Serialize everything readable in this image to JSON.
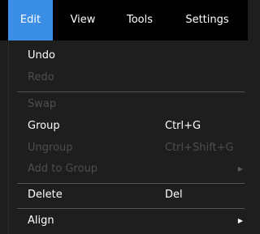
{
  "menubar": {
    "items": [
      {
        "label": "Edit",
        "active": true
      },
      {
        "label": "View"
      },
      {
        "label": "Tools"
      },
      {
        "label": "Settings"
      }
    ]
  },
  "menu": {
    "undo": {
      "label": "Undo",
      "enabled": true
    },
    "redo": {
      "label": "Redo",
      "enabled": false
    },
    "swap": {
      "label": "Swap",
      "enabled": false
    },
    "group": {
      "label": "Group",
      "shortcut": "Ctrl+G",
      "enabled": true
    },
    "ungroup": {
      "label": "Ungroup",
      "shortcut": "Ctrl+Shift+G",
      "enabled": false
    },
    "add_to_group": {
      "label": "Add to Group",
      "enabled": false,
      "submenu_icon": "chevron-right-icon"
    },
    "delete": {
      "label": "Delete",
      "shortcut": "Del",
      "enabled": true
    },
    "align": {
      "label": "Align",
      "enabled": true,
      "submenu_icon": "chevron-right-icon"
    }
  },
  "colors": {
    "accent": "#3a8ee6",
    "menubar_bg": "#000000",
    "menu_bg": "#1e1e1e",
    "text": "#ffffff",
    "disabled_text": "#4e4e4e",
    "separator": "#555555"
  }
}
